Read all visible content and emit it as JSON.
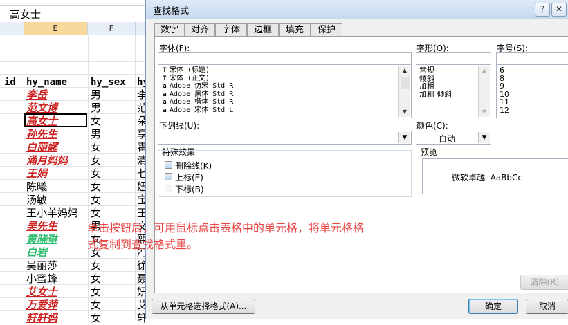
{
  "sheet": {
    "formula_value": "高女士",
    "columns": [
      {
        "label": "E",
        "selected": true
      },
      {
        "label": "F",
        "selected": false
      }
    ],
    "header_row": {
      "col_d": "id",
      "col_e": "hy_name",
      "col_f": "hy_sex",
      "col_g": "hy"
    },
    "rows": [
      {
        "name": "李岳",
        "sex": "男",
        "g": "李",
        "style": "red"
      },
      {
        "name": "范文博",
        "sex": "男",
        "g": "范",
        "style": "red"
      },
      {
        "name": "高女士",
        "sex": "女",
        "g": "朵",
        "style": "red"
      },
      {
        "name": "孙先生",
        "sex": "男",
        "g": "享",
        "style": "red"
      },
      {
        "name": "白丽娜",
        "sex": "女",
        "g": "霍",
        "style": "red"
      },
      {
        "name": "涌月妈妈",
        "sex": "女",
        "g": "清",
        "style": "red"
      },
      {
        "name": "王娟",
        "sex": "女",
        "g": "七",
        "style": "red"
      },
      {
        "name": "陈曦",
        "sex": "女",
        "g": "妞",
        "style": "plain"
      },
      {
        "name": "汤敏",
        "sex": "女",
        "g": "宝",
        "style": "plain"
      },
      {
        "name": "王小羊妈妈",
        "sex": "女",
        "g": "王",
        "style": "plain"
      },
      {
        "name": "吴先生",
        "sex": "男",
        "g": "文",
        "style": "red"
      },
      {
        "name": "黄晓琳",
        "sex": "女",
        "g": "熙",
        "style": "green"
      },
      {
        "name": "白岩",
        "sex": "女",
        "g": "冯",
        "style": "green"
      },
      {
        "name": "吴丽莎",
        "sex": "女",
        "g": "徐",
        "style": "plain"
      },
      {
        "name": "小蜜蜂",
        "sex": "女",
        "g": "聂",
        "style": "plain"
      },
      {
        "name": "艾女士",
        "sex": "女",
        "g": "妍",
        "style": "red"
      },
      {
        "name": "万爱萍",
        "sex": "女",
        "g": "艾",
        "style": "red"
      },
      {
        "name": "轩轩妈",
        "sex": "女",
        "g": "轩",
        "style": "red"
      }
    ]
  },
  "dialog": {
    "title": "查找格式",
    "help_glyph": "?",
    "close_glyph": "✕",
    "tabs": [
      {
        "label": "数字",
        "active": false
      },
      {
        "label": "对齐",
        "active": false
      },
      {
        "label": "字体",
        "active": true
      },
      {
        "label": "边框",
        "active": false
      },
      {
        "label": "填充",
        "active": false
      },
      {
        "label": "保护",
        "active": false
      }
    ],
    "font": {
      "label": "字体(F):",
      "value": "",
      "items": [
        {
          "icon": "T",
          "text": "宋体 (标题)"
        },
        {
          "icon": "T",
          "text": "宋体 (正文)"
        },
        {
          "icon": "a",
          "text": "Adobe 仿宋 Std R"
        },
        {
          "icon": "a",
          "text": "Adobe 黑体 Std R"
        },
        {
          "icon": "a",
          "text": "Adobe 楷体 Std R"
        },
        {
          "icon": "a",
          "text": "Adobe 宋体 Std L"
        }
      ]
    },
    "style": {
      "label": "字形(O):",
      "value": "",
      "items": [
        "常规",
        "倾斜",
        "加粗",
        "加粗 倾斜"
      ]
    },
    "size": {
      "label": "字号(S):",
      "value": "",
      "items": [
        "6",
        "8",
        "9",
        "10",
        "11",
        "12"
      ]
    },
    "underline": {
      "label": "下划线(U):",
      "value": ""
    },
    "color": {
      "label": "颜色(C):",
      "value": "自动"
    },
    "effects": {
      "label": "特殊效果",
      "items": [
        {
          "label": "删除线(K)",
          "enabled": true
        },
        {
          "label": "上标(E)",
          "enabled": true
        },
        {
          "label": "下标(B)",
          "enabled": false
        }
      ]
    },
    "preview": {
      "label": "预览",
      "sample": "微软卓越  AaBbCc"
    },
    "clear_button": "清除(R)",
    "pick_button": "从单元格选择格式(A)...",
    "ok_button": "确定",
    "cancel_button": "取消",
    "annotation": "单击按钮后，可用鼠标点击表格中的单元格，将单元格格式复制到查找格式里。"
  },
  "colors": {
    "annotation": "#e84545",
    "arrow": "#e84545",
    "name_red": "#cc1f1f",
    "name_green": "#2fbf6f",
    "selected_column": "#f9d99b"
  }
}
